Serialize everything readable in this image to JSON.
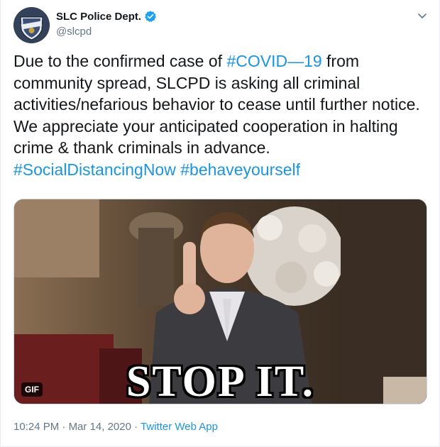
{
  "user": {
    "display_name": "SLC Police Dept.",
    "handle": "@slcpd",
    "verified_icon": "verified-badge-icon",
    "avatar_text_top": "POLICE",
    "avatar_text_bottom": "SALT LAKE CITY"
  },
  "tweet": {
    "text_part1": "Due to the confirmed case of ",
    "hashtag1": "#COVID—19",
    "text_part2": " from community spread, SLCPD is asking all criminal activities/nefarious behavior to cease until further notice. We appreciate your anticipated cooperation in halting crime & thank criminals in advance.",
    "hashtag2": "#SocialDistancingNow",
    "hashtag3": "#behaveyourself"
  },
  "media": {
    "type_badge": "GIF",
    "caption": "STOP IT."
  },
  "meta": {
    "time": "10:24 PM",
    "separator": "·",
    "date": "Mar 14, 2020",
    "source": "Twitter Web App"
  },
  "colors": {
    "link": "#1b95e0",
    "secondary_text": "#657786",
    "primary_text": "#14171a"
  }
}
